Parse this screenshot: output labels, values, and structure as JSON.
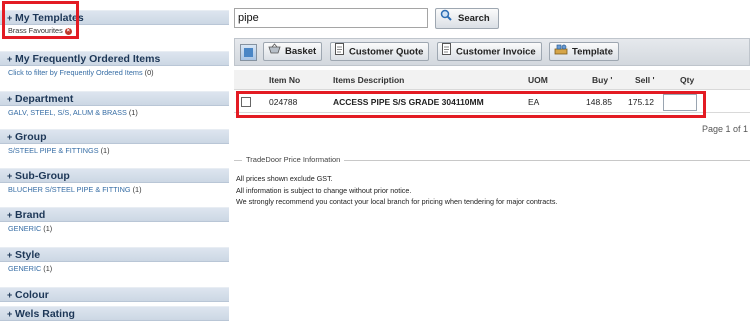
{
  "sidebar": {
    "my_templates": {
      "title": "My Templates",
      "item": "Brass Favourites"
    },
    "frequently_ordered": {
      "title": "My Frequently Ordered Items",
      "link": "Click to filter by Frequently Ordered Items",
      "count": "(0)"
    },
    "department": {
      "title": "Department",
      "link": "GALV, STEEL, S/S, ALUM & BRASS",
      "count": "(1)"
    },
    "group": {
      "title": "Group",
      "link": "S/STEEL PIPE & FITTINGS",
      "count": "(1)"
    },
    "subgroup": {
      "title": "Sub-Group",
      "link": "BLUCHER S/STEEL PIPE & FITTING",
      "count": "(1)"
    },
    "brand": {
      "title": "Brand",
      "link": "GENERIC",
      "count": "(1)"
    },
    "style": {
      "title": "Style",
      "link": "GENERIC",
      "count": "(1)"
    },
    "colour": {
      "title": "Colour"
    },
    "wels": {
      "title": "Wels Rating"
    },
    "plus_glyph": "+"
  },
  "search": {
    "value": "pipe",
    "button_label": "Search"
  },
  "toolbar": {
    "basket": "Basket",
    "customer_quote": "Customer Quote",
    "customer_invoice": "Customer Invoice",
    "template": "Template"
  },
  "table": {
    "columns": {
      "item_no": "Item No",
      "description": "Items Description",
      "uom": "UOM",
      "buy": "Buy",
      "sell": "Sell",
      "qty": "Qty"
    },
    "rows": [
      {
        "item_no": "024788",
        "description": "ACCESS PIPE S/S GRADE 304110MM",
        "uom": "EA",
        "buy": "148.85",
        "sell": "175.12",
        "qty": ""
      }
    ]
  },
  "pagination": "Page 1 of 1",
  "price_info": {
    "legend": "TradeDoor Price Information",
    "lines": [
      "All prices shown exclude GST.",
      "All information is subject to change without prior notice.",
      "We strongly recommend you contact your local branch for pricing when tendering for major contracts."
    ]
  },
  "colors": {
    "highlight": "#e31b23",
    "sidebar_header": "#ccd7e4",
    "link": "#356ca4"
  }
}
